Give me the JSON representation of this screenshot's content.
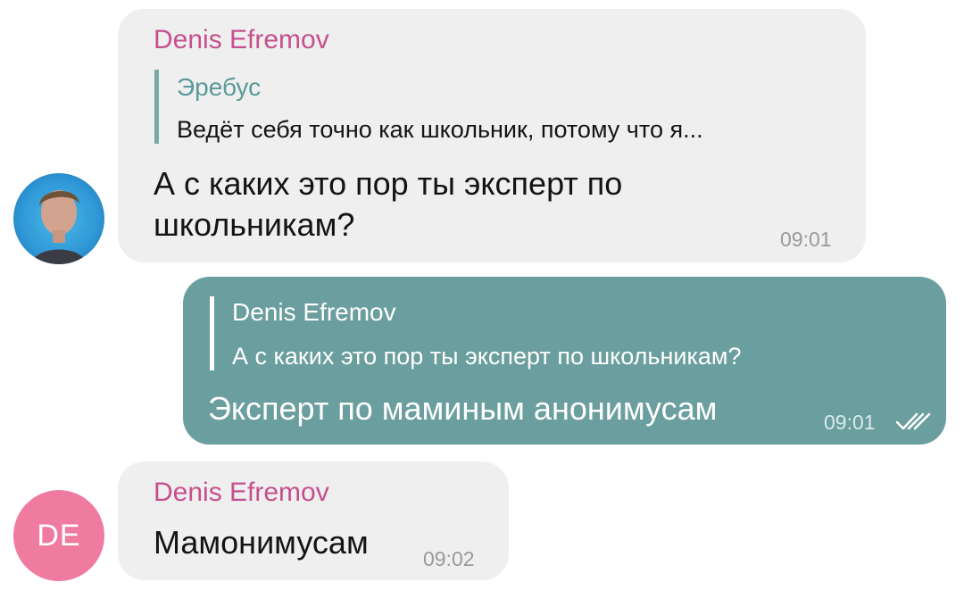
{
  "messages": [
    {
      "sender": "Denis Efremov",
      "reply": {
        "author": "Эребус",
        "text": "Ведёт себя точно как школьник, потому что я..."
      },
      "text_lines": [
        "А с каких это пор ты эксперт по",
        "школьникам?"
      ],
      "time": "09:01",
      "avatar": "photo"
    },
    {
      "outgoing": true,
      "reply": {
        "author": "Denis Efremov",
        "text": "А с каких это пор ты эксперт по школьникам?"
      },
      "text": "Эксперт по маминым анонимусам",
      "time": "09:01",
      "status_icon": "double-check-icon"
    },
    {
      "sender": "Denis Efremov",
      "text": "Мамонимусам",
      "time": "09:02",
      "avatar_initials": "DE"
    }
  ],
  "colors": {
    "incoming_bubble": "#efefef",
    "outgoing_bubble": "#6b9e9e",
    "sender_name": "#c6508e",
    "avatar_initials_bg": "#f07ba0"
  }
}
